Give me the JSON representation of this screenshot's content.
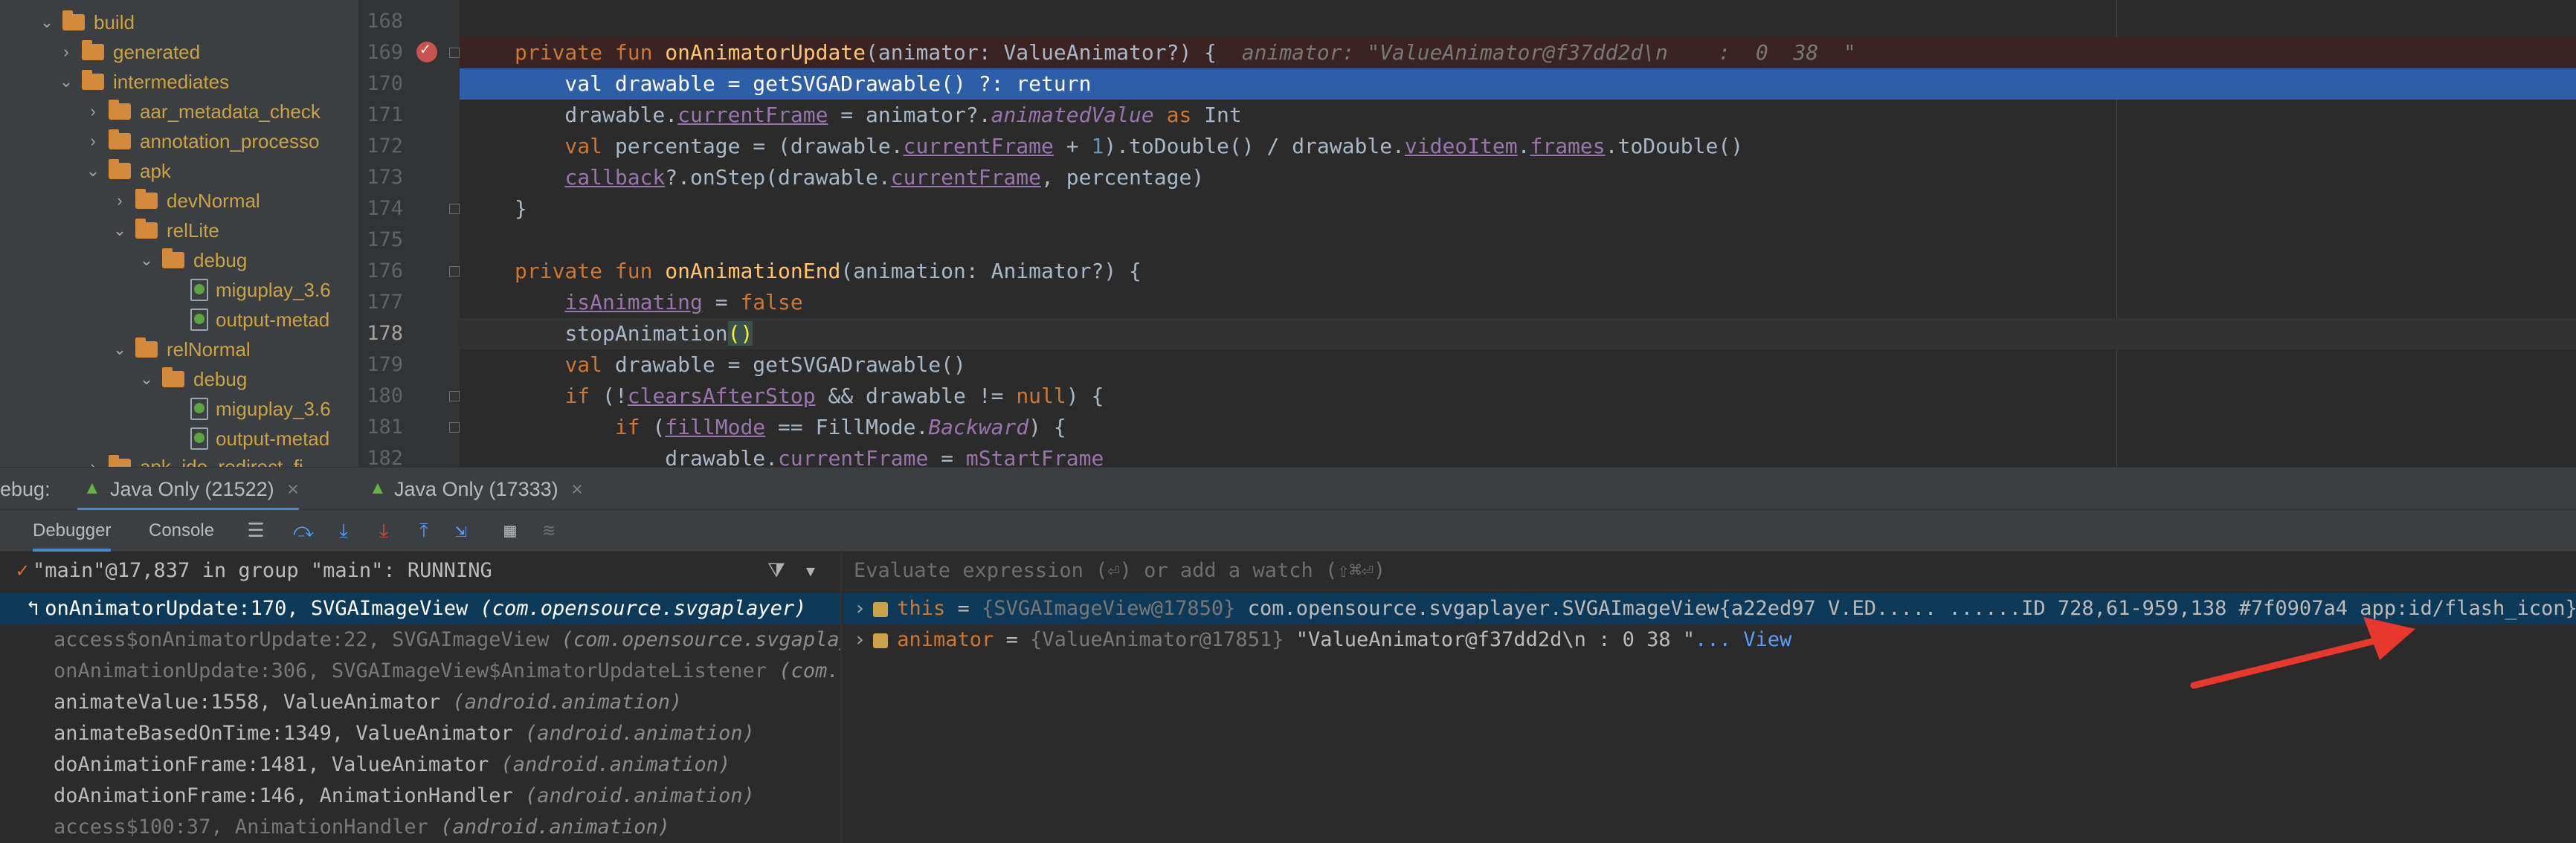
{
  "tree": {
    "items": [
      {
        "label": "build",
        "type": "folder",
        "expanded": true
      },
      {
        "label": "generated",
        "type": "folder",
        "expanded": false
      },
      {
        "label": "intermediates",
        "type": "folder",
        "expanded": true
      },
      {
        "label": "aar_metadata_check",
        "type": "folder",
        "expanded": false
      },
      {
        "label": "annotation_processo",
        "type": "folder",
        "expanded": false
      },
      {
        "label": "apk",
        "type": "folder",
        "expanded": true
      },
      {
        "label": "devNormal",
        "type": "folder",
        "expanded": false
      },
      {
        "label": "relLite",
        "type": "folder",
        "expanded": true
      },
      {
        "label": "debug",
        "type": "folder",
        "expanded": true
      },
      {
        "label": "miguplay_3.6",
        "type": "file"
      },
      {
        "label": "output-metad",
        "type": "file"
      },
      {
        "label": "relNormal",
        "type": "folder",
        "expanded": true
      },
      {
        "label": "debug",
        "type": "folder",
        "expanded": true
      },
      {
        "label": "miguplay_3.6",
        "type": "file"
      },
      {
        "label": "output-metad",
        "type": "file"
      },
      {
        "label": "apk_ide_redirect_fi",
        "type": "folder",
        "expanded": false
      }
    ]
  },
  "editor": {
    "line_numbers": [
      "168",
      "169",
      "170",
      "171",
      "172",
      "173",
      "174",
      "175",
      "176",
      "177",
      "178",
      "179",
      "180",
      "181",
      "182"
    ],
    "inline_hint": "animator: \"ValueAnimator@f37dd2d\\n    :  0  38  \"",
    "lines": {
      "l169_a": "private fun ",
      "l169_fn": "onAnimatorUpdate",
      "l169_b": "(animator: ValueAnimator?) {",
      "l170": "    val drawable = getSVGADrawable() ?: return",
      "l171_a": "    drawable.",
      "l171_p": "currentFrame",
      "l171_b": " = animator?.",
      "l171_i": "animatedValue",
      "l171_k": " as",
      "l171_c": " Int",
      "l172_k": "    val",
      "l172_a": " percentage = (drawable.",
      "l172_p": "currentFrame",
      "l172_b": " + ",
      "l172_n": "1",
      "l172_c": ").toDouble() / drawable.",
      "l172_p2": "videoItem",
      "l172_d": ".",
      "l172_p3": "frames",
      "l172_e": ".toDouble()",
      "l173_p": "callback",
      "l173_a": "?.onStep(drawable.",
      "l173_p2": "currentFrame",
      "l173_b": ", percentage)",
      "l174": "}",
      "l176_k": "private fun ",
      "l176_fn": "onAnimationEnd",
      "l176_a": "(animation: Animator?) {",
      "l177_p": "isAnimating",
      "l177_a": " = ",
      "l177_k": "false",
      "l178_a": "stopAnimation",
      "l178_b": "()",
      "l179_k": "val",
      "l179_a": " drawable = getSVGADrawable()",
      "l180_k": "if",
      "l180_a": " (!",
      "l180_p": "clearsAfterStop",
      "l180_b": " && drawable != ",
      "l180_k2": "null",
      "l180_c": ") {",
      "l181_k": "if",
      "l181_a": " (",
      "l181_p": "fillMode",
      "l181_b": " == FillMode.",
      "l181_i": "Backward",
      "l181_c": ") {",
      "l182_a": "drawable.",
      "l182_p": "currentFrame",
      "l182_b": " = ",
      "l182_p2": "mStartFrame"
    }
  },
  "debug": {
    "label": "ebug:",
    "tabs": [
      "Java Only (21522)",
      "Java Only (17333)"
    ],
    "subtabs": [
      "Debugger",
      "Console"
    ],
    "thread": "\"main\"@17,837 in group \"main\": RUNNING",
    "eval_placeholder": "Evaluate expression (⏎) or add a watch (⇧⌘⏎)",
    "frames": [
      {
        "method": "onAnimatorUpdate:170, SVGAImageView",
        "pkg": "(com.opensource.svgaplayer)"
      },
      {
        "method": "access$onAnimatorUpdate:22, SVGAImageView",
        "pkg": "(com.opensource.svgaplayer)"
      },
      {
        "method": "onAnimationUpdate:306, SVGAImageView$AnimatorUpdateListener",
        "pkg": "(com.ope"
      },
      {
        "method": "animateValue:1558, ValueAnimator",
        "pkg": "(android.animation)"
      },
      {
        "method": "animateBasedOnTime:1349, ValueAnimator",
        "pkg": "(android.animation)"
      },
      {
        "method": "doAnimationFrame:1481, ValueAnimator",
        "pkg": "(android.animation)"
      },
      {
        "method": "doAnimationFrame:146, AnimationHandler",
        "pkg": "(android.animation)"
      },
      {
        "method": "access$100:37, AnimationHandler",
        "pkg": "(android.animation)"
      }
    ],
    "vars": [
      {
        "name": "this",
        "type": "{SVGAImageView@17850}",
        "value": "com.opensource.svgaplayer.SVGAImageView{a22ed97 V.ED..... ......ID 728,61-959,138 #7f0907a4 app:id/flash_icon}",
        "link": ""
      },
      {
        "name": "animator",
        "type": "{ValueAnimator@17851}",
        "value": "\"ValueAnimator@f37dd2d\\n    :  0  38  \"",
        "link": "... View"
      }
    ]
  },
  "colors": {
    "accent": "#2d5ea7",
    "arrow": "#e8372c"
  }
}
